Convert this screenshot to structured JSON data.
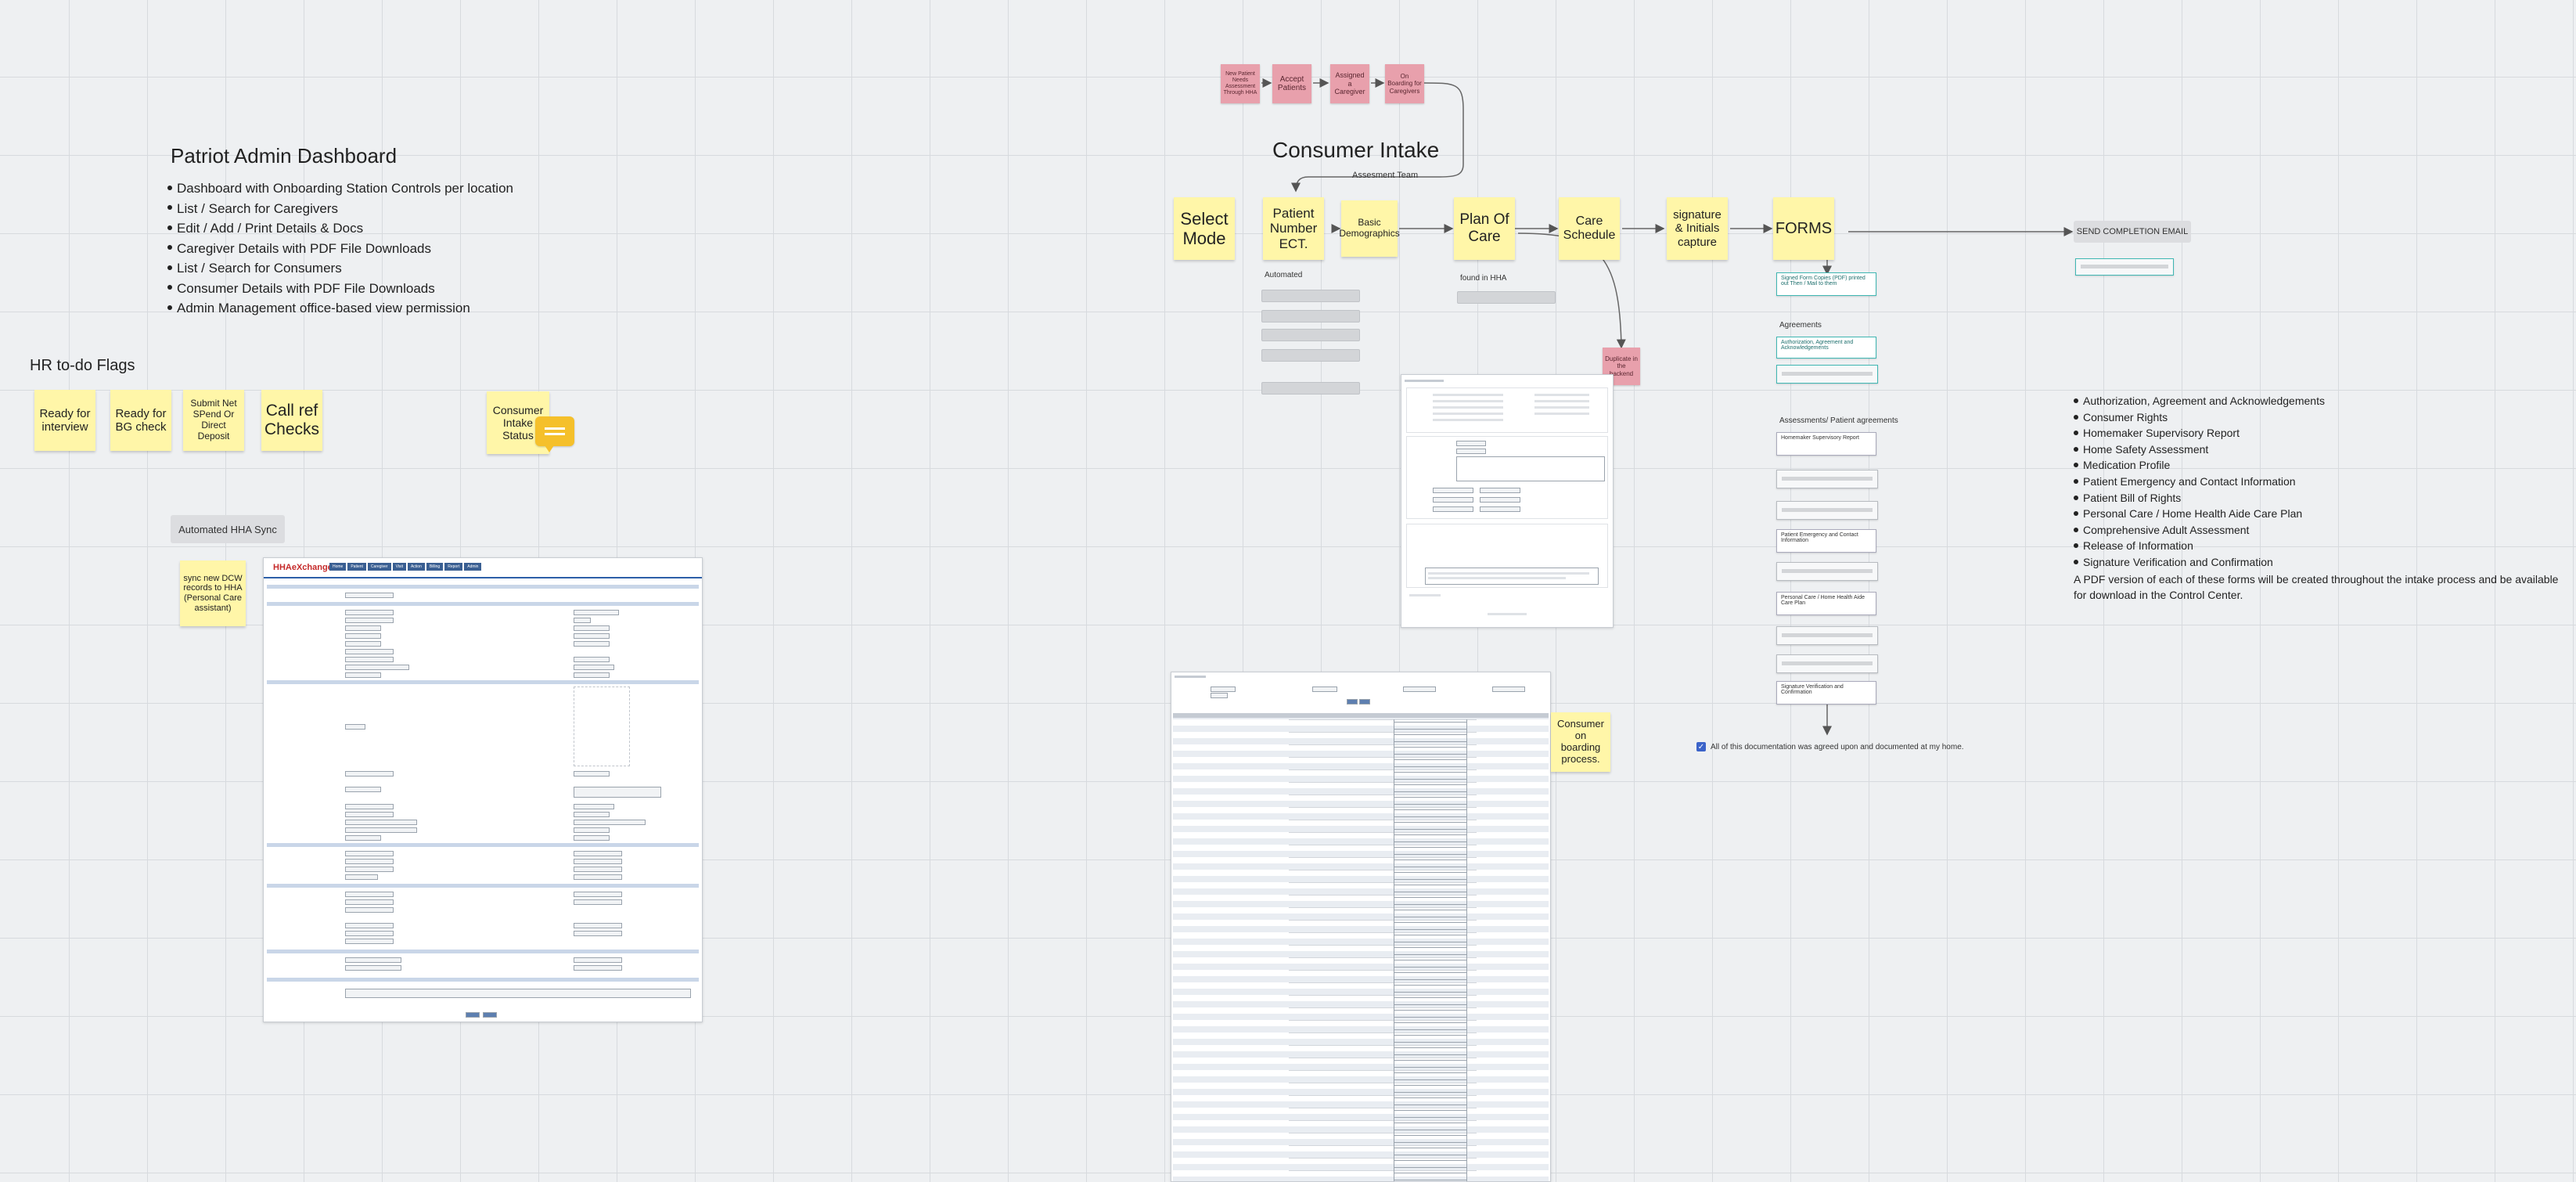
{
  "dashboard": {
    "title": "Patriot Admin Dashboard",
    "items": [
      "Dashboard with Onboarding Station Controls per location",
      "List / Search for Caregivers",
      "Edit / Add / Print Details & Docs",
      "Caregiver Details with PDF File Downloads",
      "List / Search for Consumers",
      "Consumer Details with PDF File Downloads",
      "Admin Management office-based view permission"
    ]
  },
  "hr": {
    "title": "HR to-do Flags",
    "stickies": [
      "Ready for interview",
      "Ready for BG check",
      "Submit Net SPend Or Direct Deposit",
      "Call ref Checks"
    ],
    "consumer_status": "Consumer Intake Status"
  },
  "hha": {
    "sync_label": "Automated HHA Sync",
    "sync_note": "sync new DCW records to HHA (Personal Care assistant)"
  },
  "intake": {
    "title": "Consumer Intake",
    "team_label": "Assesment Team",
    "top_steps": [
      "New Patient Needs Assessment Through HHA",
      "Accept Patients",
      "Assigned a Caregiver",
      "On Boarding for Caregivers"
    ],
    "main_steps": [
      "Select Mode",
      "Patient Number ECT.",
      "Basic Demographics",
      "Plan Of Care",
      "Care Schedule",
      "signature & Initials capture",
      "FORMS"
    ],
    "automated_label": "Automated",
    "found_label": "found in HHA",
    "duplicate_note": "Duplicate in the backend",
    "send_email": "SEND COMPLETION EMAIL",
    "onboarding_note": "Consumer on boarding process."
  },
  "forms": {
    "signed_card": "Signed Form Copies (PDF) printed out Then / Mail to them",
    "agreements_label": "Agreements",
    "agreements_card": "Authorization, Agreement and Acknowledgements",
    "assess_label": "Assessments/ Patient agreements",
    "assess_cards": [
      "Homemaker Supervisory Report",
      "",
      "",
      "Patient Emergency and Contact Information",
      "",
      "Personal Care / Home Health Aide Care Plan",
      "",
      "",
      "Signature Verification and Confirmation"
    ],
    "checkbox_label": "All of this documentation was agreed upon and documented at my home."
  },
  "form_list": {
    "items": [
      "Authorization, Agreement and Acknowledgements",
      "Consumer Rights",
      "Homemaker Supervisory Report",
      "Home Safety Assessment",
      "Medication Profile",
      "Patient Emergency and Contact Information",
      "Patient Bill of Rights",
      "Personal Care / Home Health Aide Care Plan",
      "Comprehensive Adult Assessment",
      "Release of Information",
      "Signature Verification and Confirmation"
    ],
    "note": "A PDF version of each of these forms will be created throughout the intake process and be available for download in the Control Center."
  },
  "screenshot_hha": {
    "logo": "HHAeXchange",
    "nav": [
      "Home",
      "Patient",
      "Caregiver",
      "Visit",
      "Action",
      "Billing",
      "Report",
      "Admin"
    ]
  },
  "colors": {
    "sticky": "#fff6a8",
    "pink": "#e8a0ac",
    "teal": "#3fb7b3",
    "grid": "#d7dade",
    "bg": "#eef0f2"
  }
}
